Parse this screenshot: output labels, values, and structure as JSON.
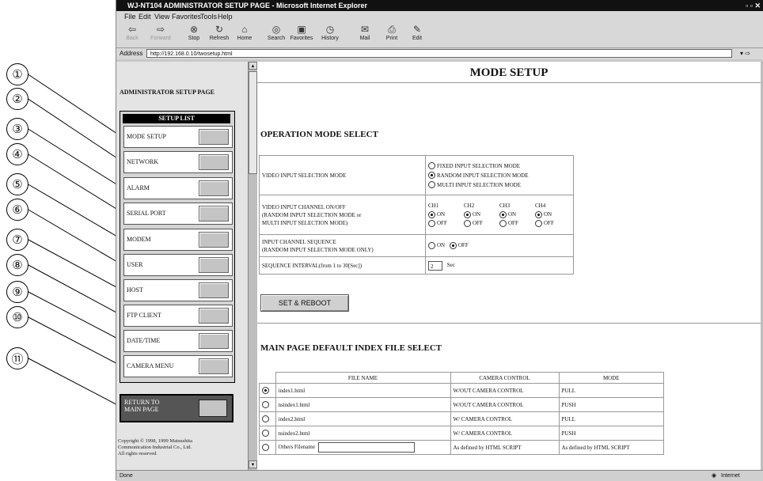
{
  "window": {
    "title": "WJ-NT104 ADMINISTRATOR SETUP PAGE - Microsoft Internet Explorer"
  },
  "menu": [
    "File",
    "Edit",
    "View",
    "Favorites",
    "Tools",
    "Help"
  ],
  "toolbar": [
    "Back",
    "Forward",
    "Stop",
    "Refresh",
    "Home",
    "Search",
    "Favorites",
    "History",
    "Mail",
    "Print",
    "Edit"
  ],
  "address": {
    "label": "Address",
    "url": "http://192.168.0.10/twosetup.html"
  },
  "status": {
    "left": "Done",
    "zone": "Internet"
  },
  "callouts": [
    "①",
    "②",
    "③",
    "④",
    "⑤",
    "⑥",
    "⑦",
    "⑧",
    "⑨",
    "⑩",
    "⑪"
  ],
  "left": {
    "heading": "ADMINISTRATOR SETUP PAGE",
    "setup_list_title": "SETUP LIST",
    "items": [
      "MODE SETUP",
      "NETWORK",
      "ALARM",
      "SERIAL PORT",
      "MODEM",
      "USER",
      "HOST",
      "FTP CLIENT",
      "DATE/TIME",
      "CAMERA MENU"
    ],
    "return_label_1": "RETURN TO",
    "return_label_2": "MAIN PAGE",
    "copyright_1": "Copyright © 1998, 1999 Matsushita",
    "copyright_2": "Communication Industrial Co., Ltd.",
    "copyright_3": "All rights reserved."
  },
  "main": {
    "title": "MODE SETUP",
    "op_heading": "OPERATION MODE SELECT",
    "video_input_label": "VIDEO INPUT SELECTION MODE",
    "video_modes": [
      "FIXED INPUT SELECTION MODE",
      "RANDOM INPUT SELECTION MODE",
      "MULTI INPUT SELECTION MODE"
    ],
    "channel_label_1": "VIDEO INPUT CHANNEL ON/OFF",
    "channel_label_2": "(RANDOM INPUT SELECTION MODE or",
    "channel_label_3": "MULTI INPUT SELECTION MODE)",
    "channels": [
      "CH1",
      "CH2",
      "CH3",
      "CH4"
    ],
    "on_label": "ON",
    "off_label": "OFF",
    "seq_label_1": "INPUT CHANNEL SEQUENCE",
    "seq_label_2": "(RANDOM INPUT SELECTION MODE ONLY)",
    "interval_label": "SEQUENCE INTERVAL(from 1 to 30[Sec])",
    "interval_value": "2",
    "interval_unit": "Sec",
    "set_reboot": "SET & REBOOT",
    "index_heading": "MAIN PAGE DEFAULT INDEX FILE SELECT",
    "index_headers": [
      "FILE NAME",
      "CAMERA CONTROL",
      "MODE"
    ],
    "index_rows": [
      {
        "file": "index1.html",
        "control": "W/OUT CAMERA CONTROL",
        "mode": "PULL"
      },
      {
        "file": "nsindex1.html",
        "control": "W/OUT CAMERA CONTROL",
        "mode": "PUSH"
      },
      {
        "file": "index2.html",
        "control": "W/ CAMERA CONTROL",
        "mode": "PULL"
      },
      {
        "file": "nsindex2.html",
        "control": "W/ CAMERA CONTROL",
        "mode": "PUSH"
      },
      {
        "file": "Others   Filename",
        "control": "As defined by HTML SCRIPT",
        "mode": "As defined by HTML SCRIPT"
      }
    ]
  }
}
